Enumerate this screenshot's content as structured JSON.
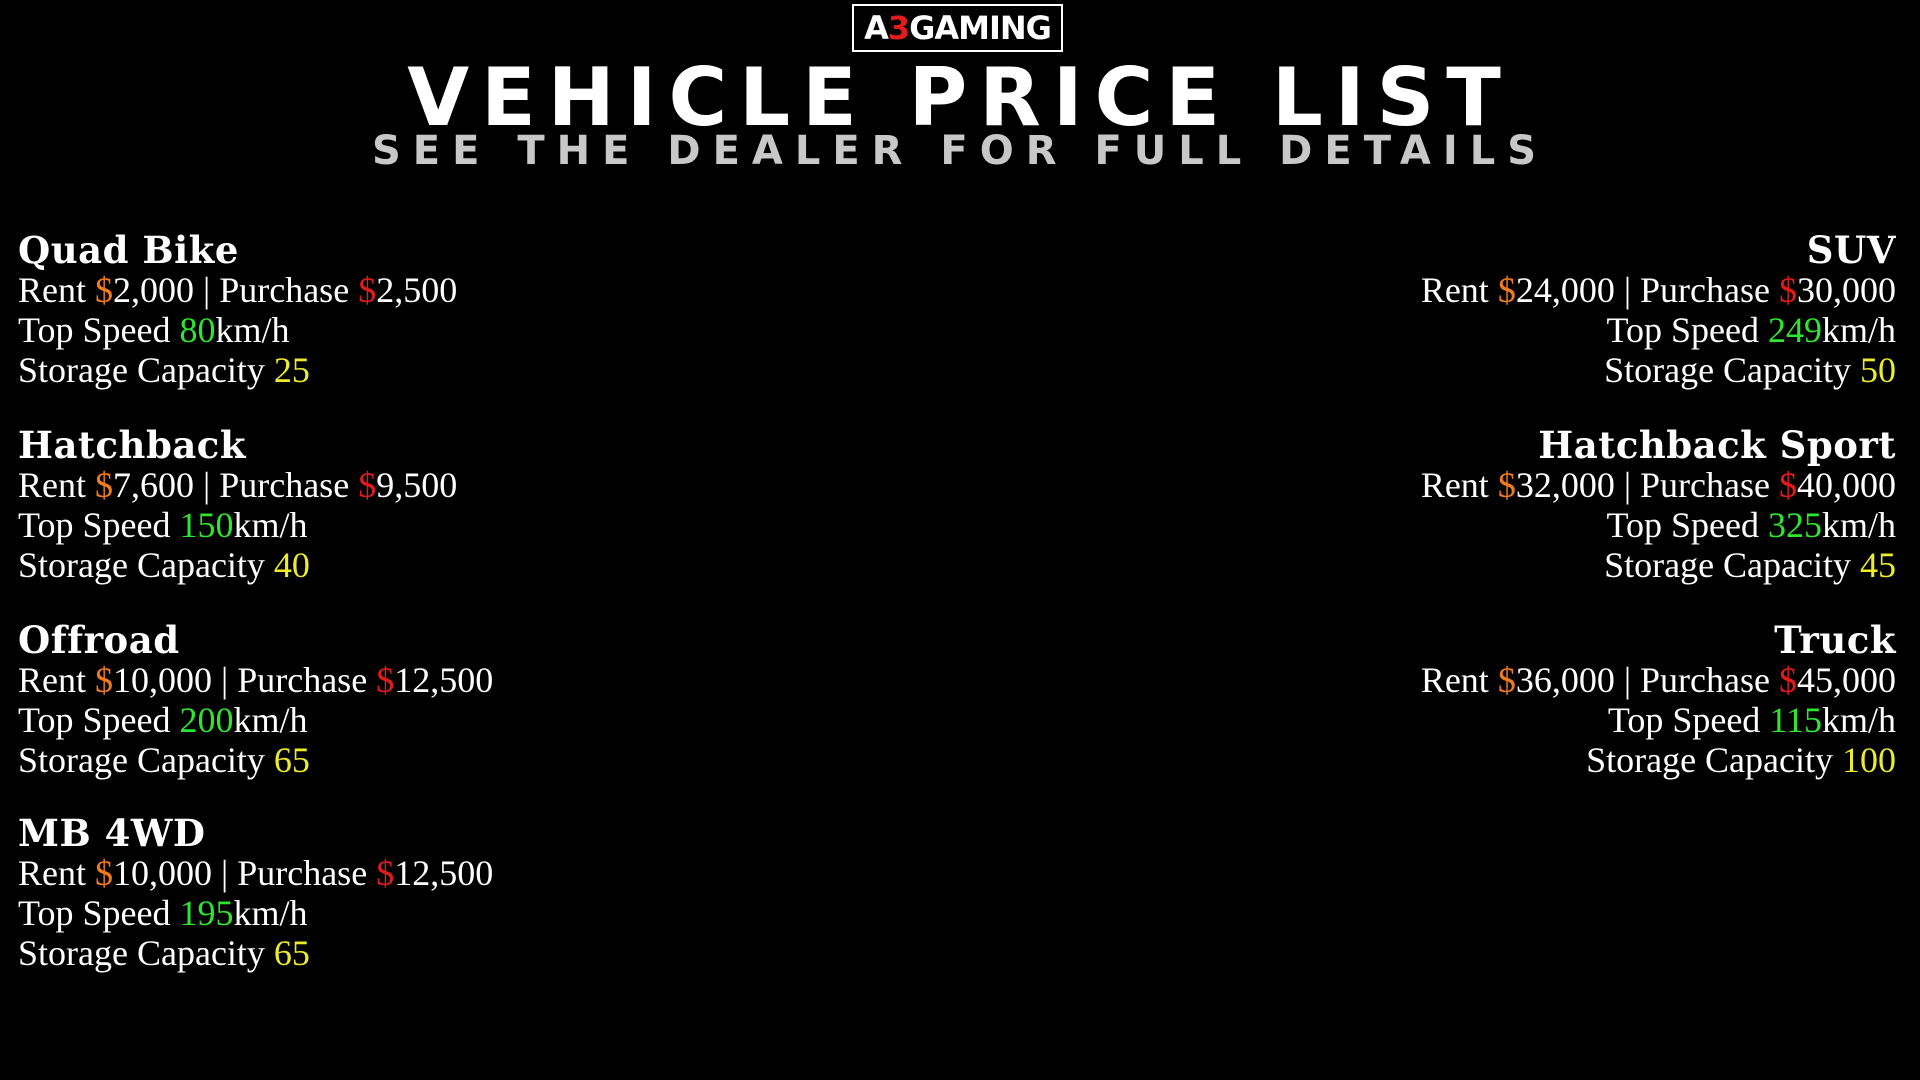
{
  "header": {
    "logo_part1": "A",
    "logo_accent": "3",
    "logo_part2": "GAMING",
    "title": "Vehicle Price List",
    "subtitle": "See the dealer for full details"
  },
  "labels": {
    "rent": "Rent",
    "purchase": "Purchase",
    "separator": "|",
    "currency": "$",
    "top_speed": "Top Speed",
    "speed_unit": "km/h",
    "storage": "Storage Capacity"
  },
  "colors": {
    "background": "#000000",
    "text": "#ffffff",
    "rent_currency": "#f07a1e",
    "purchase_currency": "#e31b1b",
    "speed_value": "#2ee62e",
    "storage_value": "#ecec2a",
    "logo_accent": "#e31b1b"
  },
  "vehicles": [
    {
      "name": "Quad Bike",
      "rent": "2,000",
      "purchase": "2,500",
      "top_speed": "80",
      "storage": "25"
    },
    {
      "name": "Hatchback",
      "rent": "7,600",
      "purchase": "9,500",
      "top_speed": "150",
      "storage": "40"
    },
    {
      "name": "Offroad",
      "rent": "10,000",
      "purchase": "12,500",
      "top_speed": "200",
      "storage": "65"
    },
    {
      "name": "MB 4WD",
      "rent": "10,000",
      "purchase": "12,500",
      "top_speed": "195",
      "storage": "65"
    },
    {
      "name": "SUV",
      "rent": "24,000",
      "purchase": "30,000",
      "top_speed": "249",
      "storage": "50"
    },
    {
      "name": "Hatchback Sport",
      "rent": "32,000",
      "purchase": "40,000",
      "top_speed": "325",
      "storage": "45"
    },
    {
      "name": "Truck",
      "rent": "36,000",
      "purchase": "45,000",
      "top_speed": "115",
      "storage": "100"
    }
  ]
}
